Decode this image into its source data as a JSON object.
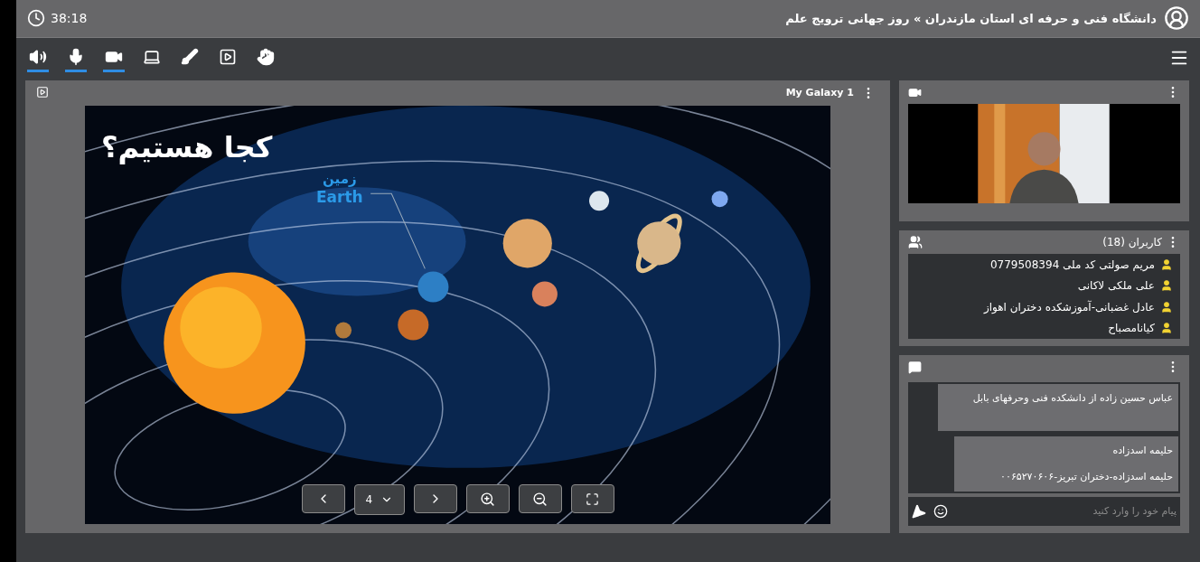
{
  "header": {
    "timer": "38:18",
    "breadcrumb": "دانشگاه فنی و حرفه ای استان مازندران » روز جهانی ترویج علم"
  },
  "toolbar": [
    {
      "kind": "audio",
      "on": true
    },
    {
      "kind": "mic",
      "on": true
    },
    {
      "kind": "camera",
      "on": true
    },
    {
      "kind": "screen",
      "on": false
    },
    {
      "kind": "draw",
      "on": false
    },
    {
      "kind": "media",
      "on": false
    },
    {
      "kind": "hand",
      "on": false
    }
  ],
  "presentation": {
    "title": "My Galaxy 1",
    "slide": {
      "heading": "کجا هستیم؟",
      "label_fa": "زمین",
      "label_en": "Earth"
    },
    "page": "4"
  },
  "users": {
    "title": "کاربران (18)",
    "items": [
      "مریم صولتی کد ملی 0779508394",
      "علی ملکی لاکانی",
      "عادل غضبانی-آموزشکده دختران اهواز",
      "کیانامصباح"
    ]
  },
  "chat": {
    "messages": [
      {
        "lines": [
          "عباس حسین زاده از دانشکده فنی  وحرفهای بابل"
        ]
      },
      {
        "lines": [
          "حلیمه اسدزاده",
          "حلیمه اسدزاده-دختران تبریز-۰۰۶۵۲۷۰۶۰۶"
        ]
      }
    ],
    "placeholder": "پیام خود را وارد کنید"
  }
}
